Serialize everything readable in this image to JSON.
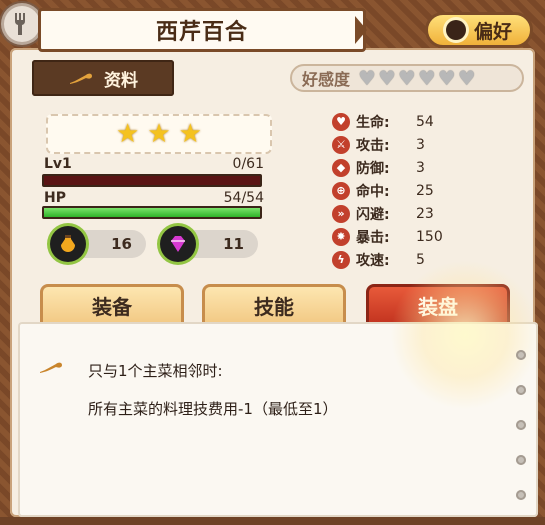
{
  "header": {
    "title": "西芹百合",
    "preference_label": "偏好"
  },
  "info_tab": {
    "label": "资料"
  },
  "favor": {
    "label": "好感度",
    "hearts_total": 6,
    "hearts_filled": 0
  },
  "rarity": {
    "stars": 3
  },
  "level": {
    "label": "Lv1",
    "exp": "0/61",
    "exp_fraction": 0
  },
  "hp": {
    "label": "HP",
    "value": "54/54",
    "fraction": 1
  },
  "resources": [
    {
      "icon": "potion-icon",
      "value": "16"
    },
    {
      "icon": "gem-icon",
      "value": "11"
    }
  ],
  "stats": [
    {
      "icon": "heart-icon",
      "label": "生命:",
      "value": "54"
    },
    {
      "icon": "sword-icon",
      "label": "攻击:",
      "value": "3"
    },
    {
      "icon": "shield-icon",
      "label": "防御:",
      "value": "3"
    },
    {
      "icon": "target-icon",
      "label": "命中:",
      "value": "25"
    },
    {
      "icon": "dodge-icon",
      "label": "闪避:",
      "value": "23"
    },
    {
      "icon": "crit-icon",
      "label": "暴击:",
      "value": "150"
    },
    {
      "icon": "speed-icon",
      "label": "攻速:",
      "value": "5"
    }
  ],
  "tabs": [
    {
      "label": "装备",
      "active": false
    },
    {
      "label": "技能",
      "active": false
    },
    {
      "label": "装盘",
      "active": true
    }
  ],
  "detail": {
    "line1": "只与1个主菜相邻时:",
    "line2": "所有主菜的料理技费用-1（最低至1）"
  },
  "colors": {
    "accent": "#c2331f",
    "hp_bar": "#2fb329",
    "frame": "#7a4a28"
  }
}
